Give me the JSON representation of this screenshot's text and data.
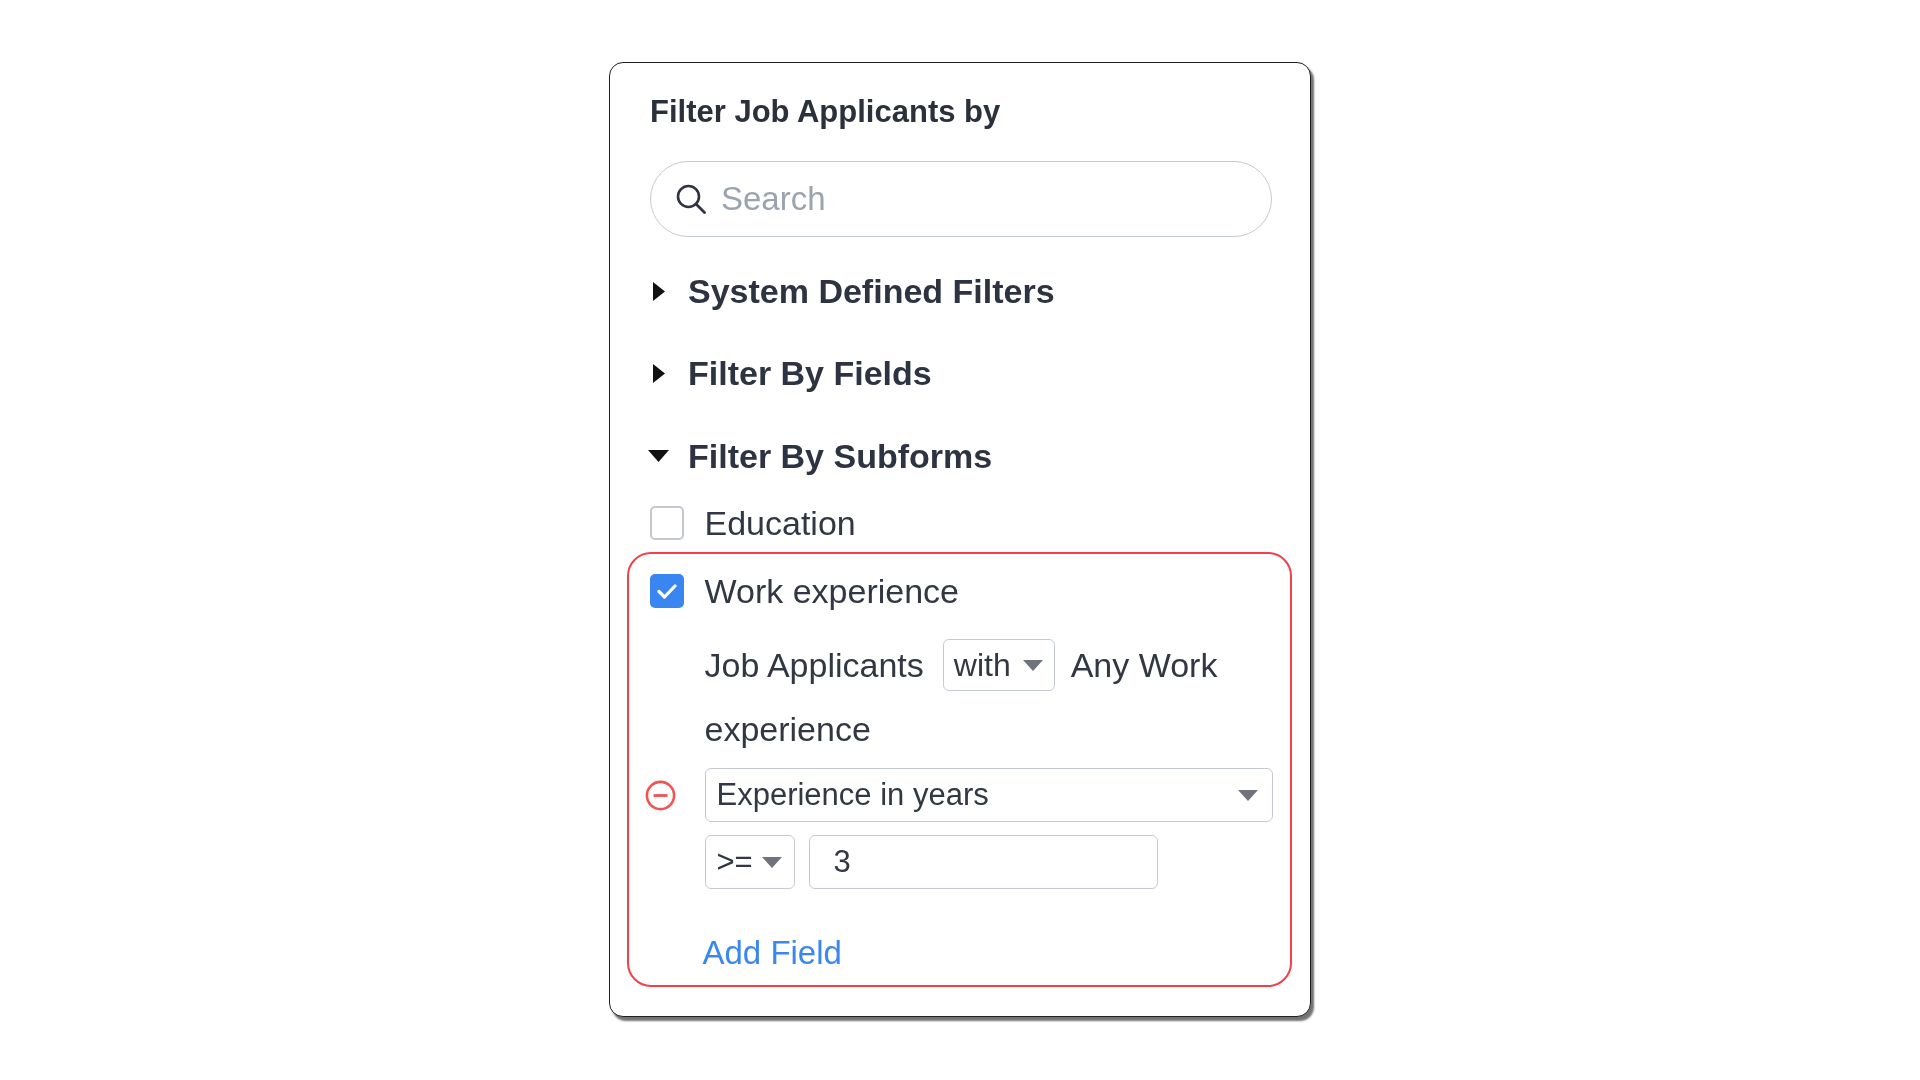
{
  "panel": {
    "title": "Filter Job Applicants by"
  },
  "search": {
    "placeholder": "Search"
  },
  "sections": [
    {
      "label": "System Defined Filters",
      "expanded": false
    },
    {
      "label": "Filter By Fields",
      "expanded": false
    },
    {
      "label": "Filter By Subforms",
      "expanded": true,
      "subforms": [
        {
          "label": "Education",
          "checked": false,
          "highlighted": false
        },
        {
          "label": "Work experience",
          "checked": true,
          "highlighted": true,
          "condition": {
            "subject": "Job Applicants",
            "operator": "with",
            "object_lines": [
              "Any Work",
              "experience"
            ]
          },
          "fields": [
            {
              "field": "Experience in years",
              "comparator": ">=",
              "value": "3"
            }
          ],
          "add_link": "Add Field"
        }
      ]
    }
  ]
}
